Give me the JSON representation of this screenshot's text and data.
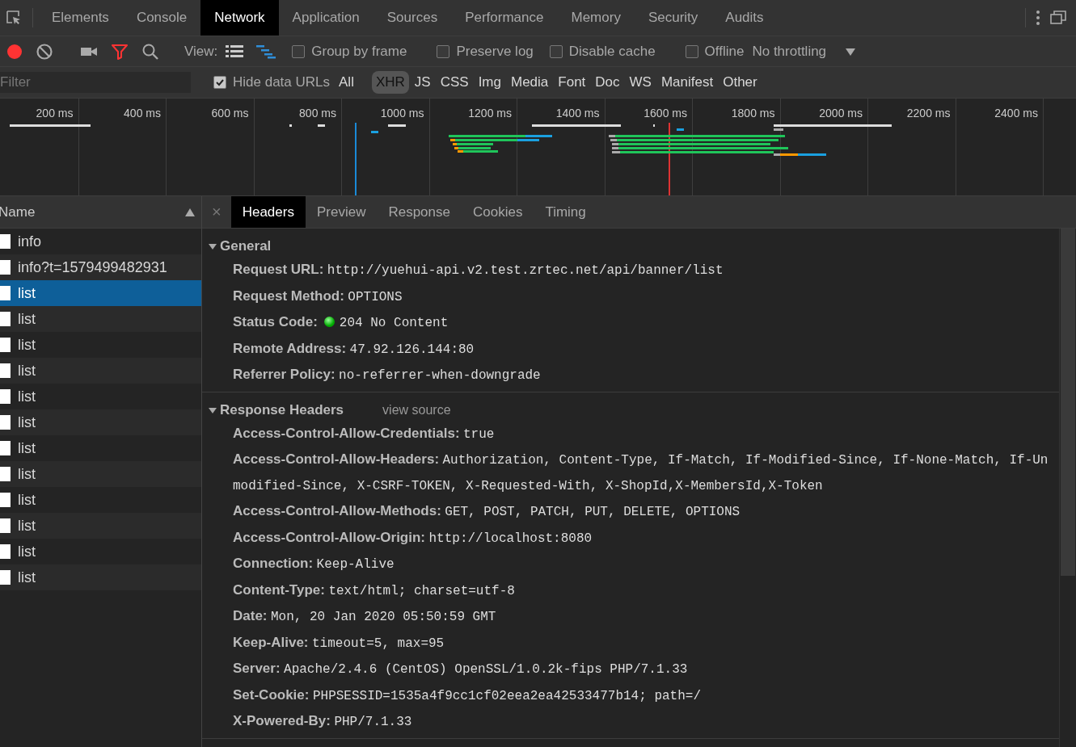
{
  "panel_tabs": [
    {
      "label": "Elements",
      "selected": false
    },
    {
      "label": "Console",
      "selected": false
    },
    {
      "label": "Network",
      "selected": true
    },
    {
      "label": "Application",
      "selected": false
    },
    {
      "label": "Sources",
      "selected": false
    },
    {
      "label": "Performance",
      "selected": false
    },
    {
      "label": "Memory",
      "selected": false
    },
    {
      "label": "Security",
      "selected": false
    },
    {
      "label": "Audits",
      "selected": false
    }
  ],
  "toolbar": {
    "recording": true,
    "filter_active": true,
    "view_label": "View:",
    "checkboxes": [
      {
        "label": "Group by frame",
        "checked": false
      },
      {
        "label": "Preserve log",
        "checked": false
      },
      {
        "label": "Disable cache",
        "checked": false
      },
      {
        "label": "Offline",
        "checked": false
      }
    ],
    "throttling": "No throttling"
  },
  "filter": {
    "placeholder": "Filter",
    "hide_data_urls": {
      "label": "Hide data URLs",
      "checked": true
    },
    "types": [
      {
        "label": "All",
        "selected": false
      },
      {
        "label": "XHR",
        "selected": true
      },
      {
        "label": "JS",
        "selected": false
      },
      {
        "label": "CSS",
        "selected": false
      },
      {
        "label": "Img",
        "selected": false
      },
      {
        "label": "Media",
        "selected": false
      },
      {
        "label": "Font",
        "selected": false
      },
      {
        "label": "Doc",
        "selected": false
      },
      {
        "label": "WS",
        "selected": false
      },
      {
        "label": "Manifest",
        "selected": false
      },
      {
        "label": "Other",
        "selected": false
      }
    ]
  },
  "overview": {
    "ticks": [
      "200 ms",
      "400 ms",
      "600 ms",
      "800 ms",
      "1000 ms",
      "1200 ms",
      "1400 ms",
      "1600 ms",
      "1800 ms",
      "2000 ms",
      "2200 ms",
      "2400 ms"
    ]
  },
  "requests": {
    "column": "Name",
    "rows": [
      {
        "name": "info",
        "selected": false
      },
      {
        "name": "info?t=1579499482931",
        "selected": false
      },
      {
        "name": "list",
        "selected": true
      },
      {
        "name": "list",
        "selected": false
      },
      {
        "name": "list",
        "selected": false
      },
      {
        "name": "list",
        "selected": false
      },
      {
        "name": "list",
        "selected": false
      },
      {
        "name": "list",
        "selected": false
      },
      {
        "name": "list",
        "selected": false
      },
      {
        "name": "list",
        "selected": false
      },
      {
        "name": "list",
        "selected": false
      },
      {
        "name": "list",
        "selected": false
      },
      {
        "name": "list",
        "selected": false
      },
      {
        "name": "list",
        "selected": false
      }
    ]
  },
  "detail": {
    "close": "×",
    "tabs": [
      {
        "label": "Headers",
        "selected": true
      },
      {
        "label": "Preview",
        "selected": false
      },
      {
        "label": "Response",
        "selected": false
      },
      {
        "label": "Cookies",
        "selected": false
      },
      {
        "label": "Timing",
        "selected": false
      }
    ],
    "sections": [
      {
        "title": "General",
        "expanded": true,
        "fields": [
          {
            "name": "Request URL:",
            "value": "http://yuehui-api.v2.test.zrtec.net/api/banner/list"
          },
          {
            "name": "Request Method:",
            "value": "OPTIONS"
          },
          {
            "name": "Status Code:",
            "value": "204 No Content",
            "kind": "status"
          },
          {
            "name": "Remote Address:",
            "value": "47.92.126.144:80"
          },
          {
            "name": "Referrer Policy:",
            "value": "no-referrer-when-downgrade"
          }
        ]
      },
      {
        "title": "Response Headers",
        "expanded": true,
        "link": "view source",
        "fields": [
          {
            "name": "Access-Control-Allow-Credentials:",
            "value": "true"
          },
          {
            "name": "Access-Control-Allow-Headers:",
            "value": "Authorization, Content-Type, If-Match, If-Modified-Since, If-None-Match, If-Unmodified-Since, X-CSRF-TOKEN, X-Requested-With, X-ShopId,X-MembersId,X-Token"
          },
          {
            "name": "Access-Control-Allow-Methods:",
            "value": "GET, POST, PATCH, PUT, DELETE, OPTIONS"
          },
          {
            "name": "Access-Control-Allow-Origin:",
            "value": "http://localhost:8080"
          },
          {
            "name": "Connection:",
            "value": "Keep-Alive"
          },
          {
            "name": "Content-Type:",
            "value": "text/html; charset=utf-8"
          },
          {
            "name": "Date:",
            "value": "Mon, 20 Jan 2020 05:50:59 GMT"
          },
          {
            "name": "Keep-Alive:",
            "value": "timeout=5, max=95"
          },
          {
            "name": "Server:",
            "value": "Apache/2.4.6 (CentOS) OpenSSL/1.0.2k-fips PHP/7.1.33"
          },
          {
            "name": "Set-Cookie:",
            "value": "PHPSESSID=1535a4f9cc1cf02eea2ea42533477b14; path=/"
          },
          {
            "name": "X-Powered-By:",
            "value": "PHP/7.1.33"
          }
        ]
      }
    ]
  }
}
